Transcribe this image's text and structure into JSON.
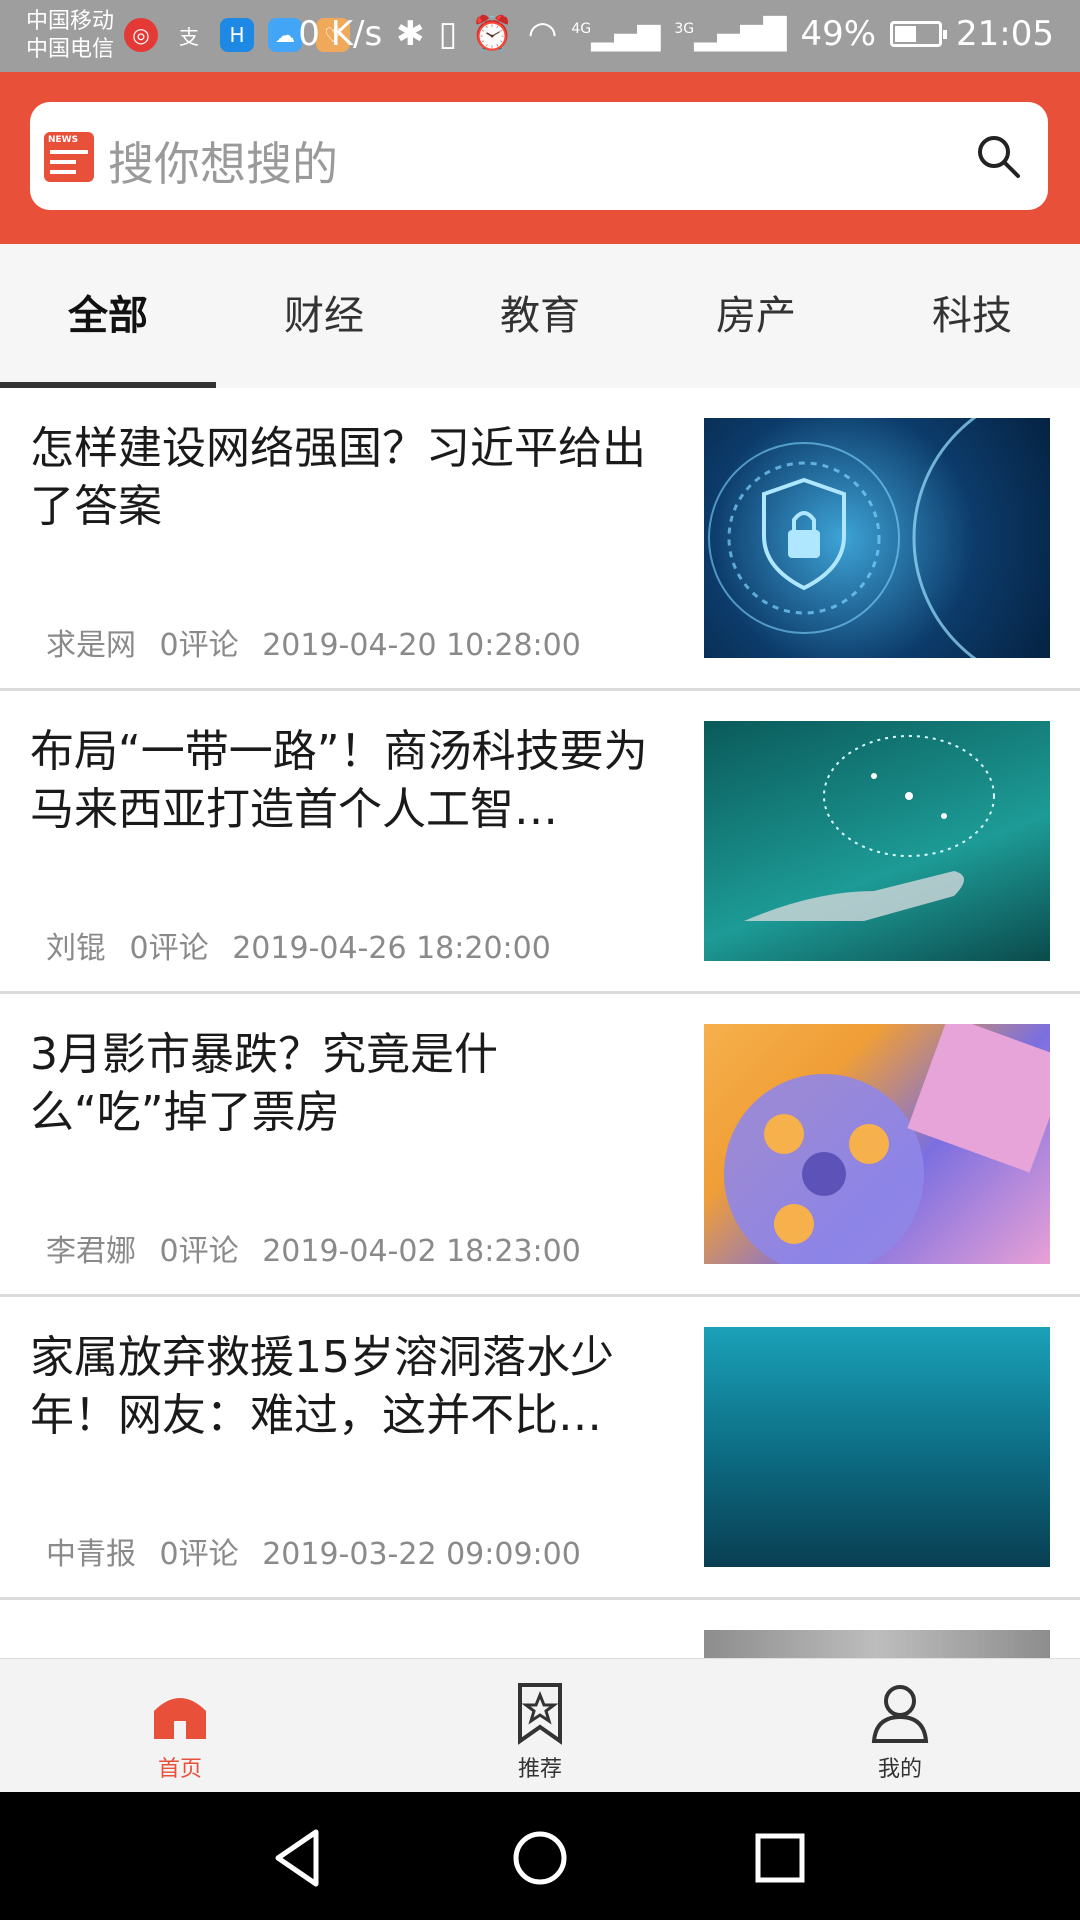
{
  "status_bar": {
    "carrier_1": "中国移动",
    "carrier_2": "中国电信",
    "net_speed": "0 K/s",
    "net_4g": "4G",
    "net_3g": "3G",
    "battery_percent": "49%",
    "battery_level": 0.49,
    "time": "21:05",
    "icons": [
      "netease-app-icon",
      "alipay-app-icon",
      "app-h-icon",
      "app-cloud-icon",
      "app-heart-icon",
      "bluetooth-icon",
      "vibrate-icon",
      "alarm-icon",
      "wifi-icon",
      "signal-icon",
      "battery-icon"
    ]
  },
  "header": {
    "search_placeholder": "搜你想搜的",
    "news_icon_tag": "NEWS",
    "accent_color": "#e8503a"
  },
  "tabs": [
    {
      "label": "全部",
      "active": true
    },
    {
      "label": "财经",
      "active": false
    },
    {
      "label": "教育",
      "active": false
    },
    {
      "label": "房产",
      "active": false
    },
    {
      "label": "科技",
      "active": false
    }
  ],
  "articles": [
    {
      "title": "怎样建设网络强国？习近平给出了答案",
      "source": "求是网",
      "comments": "0评论",
      "time": "2019-04-20 10:28:00",
      "thumb": "cyber-security-lock-image"
    },
    {
      "title": "布局“一带一路”！商汤科技要为马来西亚打造首个人工智…",
      "source": "刘锟",
      "comments": "0评论",
      "time": "2019-04-26 18:20:00",
      "thumb": "robot-hand-ai-brain-image"
    },
    {
      "title": "3月影市暴跌？究竟是什么“吃”掉了票房",
      "source": "李君娜",
      "comments": "0评论",
      "time": "2019-04-02 18:23:00",
      "thumb": "film-reel-tickets-image"
    },
    {
      "title": "家属放弃救援15岁溶洞落水少年！网友：难过，这并不比…",
      "source": "中青报",
      "comments": "0评论",
      "time": "2019-03-22 09:09:00",
      "thumb": "underwater-image"
    },
    {
      "title": "",
      "source": "",
      "comments": "",
      "time": "",
      "thumb": "partial-image"
    }
  ],
  "bottom_nav": [
    {
      "label": "首页",
      "icon": "home-icon",
      "active": true
    },
    {
      "label": "推荐",
      "icon": "bookmark-star-icon",
      "active": false
    },
    {
      "label": "我的",
      "icon": "person-icon",
      "active": false
    }
  ],
  "system_nav": {
    "icons": [
      "back-icon",
      "home-circle-icon",
      "recents-icon"
    ]
  }
}
